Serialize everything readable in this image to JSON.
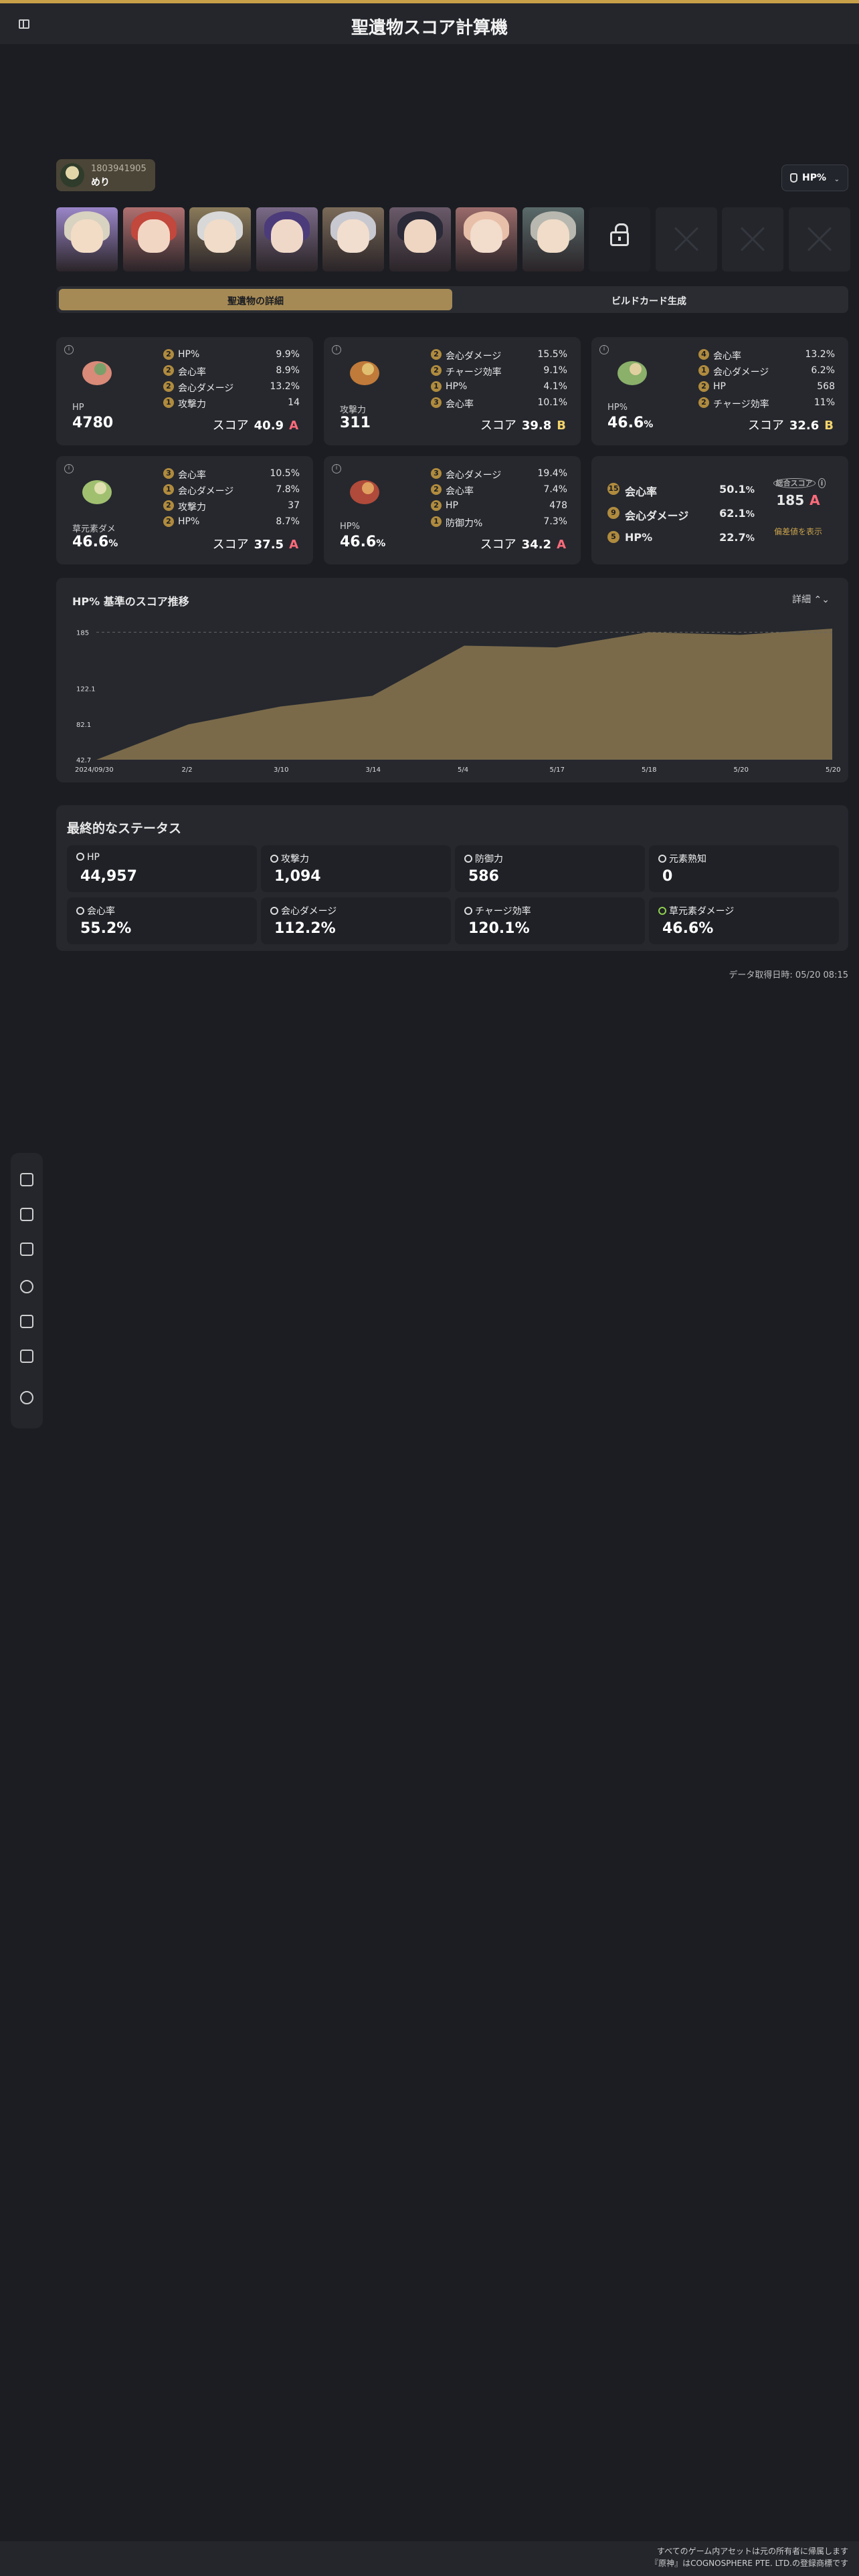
{
  "header": {
    "title": "聖遺物スコア計算機"
  },
  "profile": {
    "uid": "1803941905",
    "name": "めり"
  },
  "score_type": {
    "label": "HP%"
  },
  "characters": [
    {
      "name": "char-1",
      "bg": "#9a86c8",
      "hair": "#d8d2c0",
      "face": "#f2dcc6"
    },
    {
      "name": "char-2",
      "bg": "#b07070",
      "hair": "#c2473c",
      "face": "#f2d6c4"
    },
    {
      "name": "char-3",
      "bg": "#8a7a5a",
      "hair": "#d8d8d8",
      "face": "#f0dcc8"
    },
    {
      "name": "char-4",
      "bg": "#7a6a88",
      "hair": "#4b3b7a",
      "face": "#f0d8c8"
    },
    {
      "name": "char-5",
      "bg": "#7a6a58",
      "hair": "#c8c8d0",
      "face": "#f2dece"
    },
    {
      "name": "char-6",
      "bg": "#6a5a6a",
      "hair": "#2a2a38",
      "face": "#efd6c2"
    },
    {
      "name": "char-7",
      "bg": "#9a6a6a",
      "hair": "#e8bfa8",
      "face": "#f2dccc"
    },
    {
      "name": "char-8",
      "bg": "#5a6a6a",
      "hair": "#b8b8b0",
      "face": "#f0dcc8"
    }
  ],
  "tabs": [
    {
      "label": "聖遺物の詳細"
    },
    {
      "label": "ビルドカード生成"
    }
  ],
  "artifacts": [
    {
      "main_label": "HP",
      "main_value": "4780",
      "score_label": "スコア",
      "score": "40.9",
      "grade": "A",
      "subs": [
        {
          "rolls": "2",
          "name": "HP%",
          "value": "9.9%"
        },
        {
          "rolls": "2",
          "name": "会心率",
          "value": "8.9%"
        },
        {
          "rolls": "2",
          "name": "会心ダメージ",
          "value": "13.2%"
        },
        {
          "rolls": "1",
          "name": "攻撃力",
          "value": "14"
        }
      ]
    },
    {
      "main_label": "攻撃力",
      "main_value": "311",
      "score_label": "スコア",
      "score": "39.8",
      "grade": "B",
      "subs": [
        {
          "rolls": "2",
          "name": "会心ダメージ",
          "value": "15.5%"
        },
        {
          "rolls": "2",
          "name": "チャージ効率",
          "value": "9.1%"
        },
        {
          "rolls": "1",
          "name": "HP%",
          "value": "4.1%"
        },
        {
          "rolls": "3",
          "name": "会心率",
          "value": "10.1%"
        }
      ]
    },
    {
      "main_label": "HP%",
      "main_value": "46.6",
      "main_unit": "%",
      "score_label": "スコア",
      "score": "32.6",
      "grade": "B",
      "subs": [
        {
          "rolls": "4",
          "name": "会心率",
          "value": "13.2%"
        },
        {
          "rolls": "1",
          "name": "会心ダメージ",
          "value": "6.2%"
        },
        {
          "rolls": "2",
          "name": "HP",
          "value": "568"
        },
        {
          "rolls": "2",
          "name": "チャージ効率",
          "value": "11%"
        }
      ]
    },
    {
      "main_label": "草元素ダメ",
      "main_value": "46.6",
      "main_unit": "%",
      "score_label": "スコア",
      "score": "37.5",
      "grade": "A",
      "subs": [
        {
          "rolls": "3",
          "name": "会心率",
          "value": "10.5%"
        },
        {
          "rolls": "1",
          "name": "会心ダメージ",
          "value": "7.8%"
        },
        {
          "rolls": "2",
          "name": "攻撃力",
          "value": "37"
        },
        {
          "rolls": "2",
          "name": "HP%",
          "value": "8.7%"
        }
      ]
    },
    {
      "main_label": "HP%",
      "main_value": "46.6",
      "main_unit": "%",
      "score_label": "スコア",
      "score": "34.2",
      "grade": "A",
      "subs": [
        {
          "rolls": "3",
          "name": "会心ダメージ",
          "value": "19.4%"
        },
        {
          "rolls": "2",
          "name": "会心率",
          "value": "7.4%"
        },
        {
          "rolls": "2",
          "name": "HP",
          "value": "478"
        },
        {
          "rolls": "1",
          "name": "防御力%",
          "value": "7.3%"
        }
      ]
    }
  ],
  "summary": {
    "rows": [
      {
        "rolls": "15",
        "name": "会心率",
        "value": "50.1",
        "unit": "%"
      },
      {
        "rolls": "9",
        "name": "会心ダメージ",
        "value": "62.1",
        "unit": "%"
      },
      {
        "rolls": "5",
        "name": "HP%",
        "value": "22.7",
        "unit": "%"
      }
    ],
    "total_label": "総合スコア",
    "total_value": "185",
    "total_grade": "A",
    "link": "偏差値を表示"
  },
  "chart_data": {
    "type": "area",
    "title": "HP% 基準のスコア推移",
    "detail_label": "詳細",
    "x": [
      "2024/09/30",
      "2/2",
      "3/10",
      "3/14",
      "5/4",
      "5/17",
      "5/18",
      "5/20",
      "5/20"
    ],
    "values": [
      42.7,
      82.1,
      102.0,
      114.0,
      170.0,
      168.0,
      185.0,
      182.0,
      189.0
    ],
    "ylim": [
      42.7,
      189.0
    ],
    "yticks": [
      "185",
      "122.1",
      "82.1",
      "42.7"
    ],
    "reference_line": 185,
    "fill": "#7a6a4a"
  },
  "final": {
    "title": "最終的なステータス",
    "stats": [
      {
        "name": "HP",
        "value": "44,957",
        "icon": "hp-icon"
      },
      {
        "name": "攻撃力",
        "value": "1,094",
        "icon": "sword-icon"
      },
      {
        "name": "防御力",
        "value": "586",
        "icon": "shield-icon"
      },
      {
        "name": "元素熟知",
        "value": "0",
        "icon": "mastery-icon"
      },
      {
        "name": "会心率",
        "value": "55.2%",
        "icon": "crit-rate-icon"
      },
      {
        "name": "会心ダメージ",
        "value": "112.2%",
        "icon": "crit-dmg-icon"
      },
      {
        "name": "チャージ効率",
        "value": "120.1%",
        "icon": "recharge-icon"
      },
      {
        "name": "草元素ダメージ",
        "value": "46.6%",
        "icon": "dendro-icon"
      }
    ]
  },
  "timestamp": "データ取得日時: 05/20 08:15",
  "footer": {
    "line1": "すべてのゲーム内アセットは元の所有者に帰属します",
    "line2": "『原神』はCOGNOSPHERE PTE. LTD.の登録商標です"
  },
  "colors": {
    "accent": "#c8a04a",
    "grade_a": "#ff6b7b",
    "grade_b": "#f2d36b"
  }
}
